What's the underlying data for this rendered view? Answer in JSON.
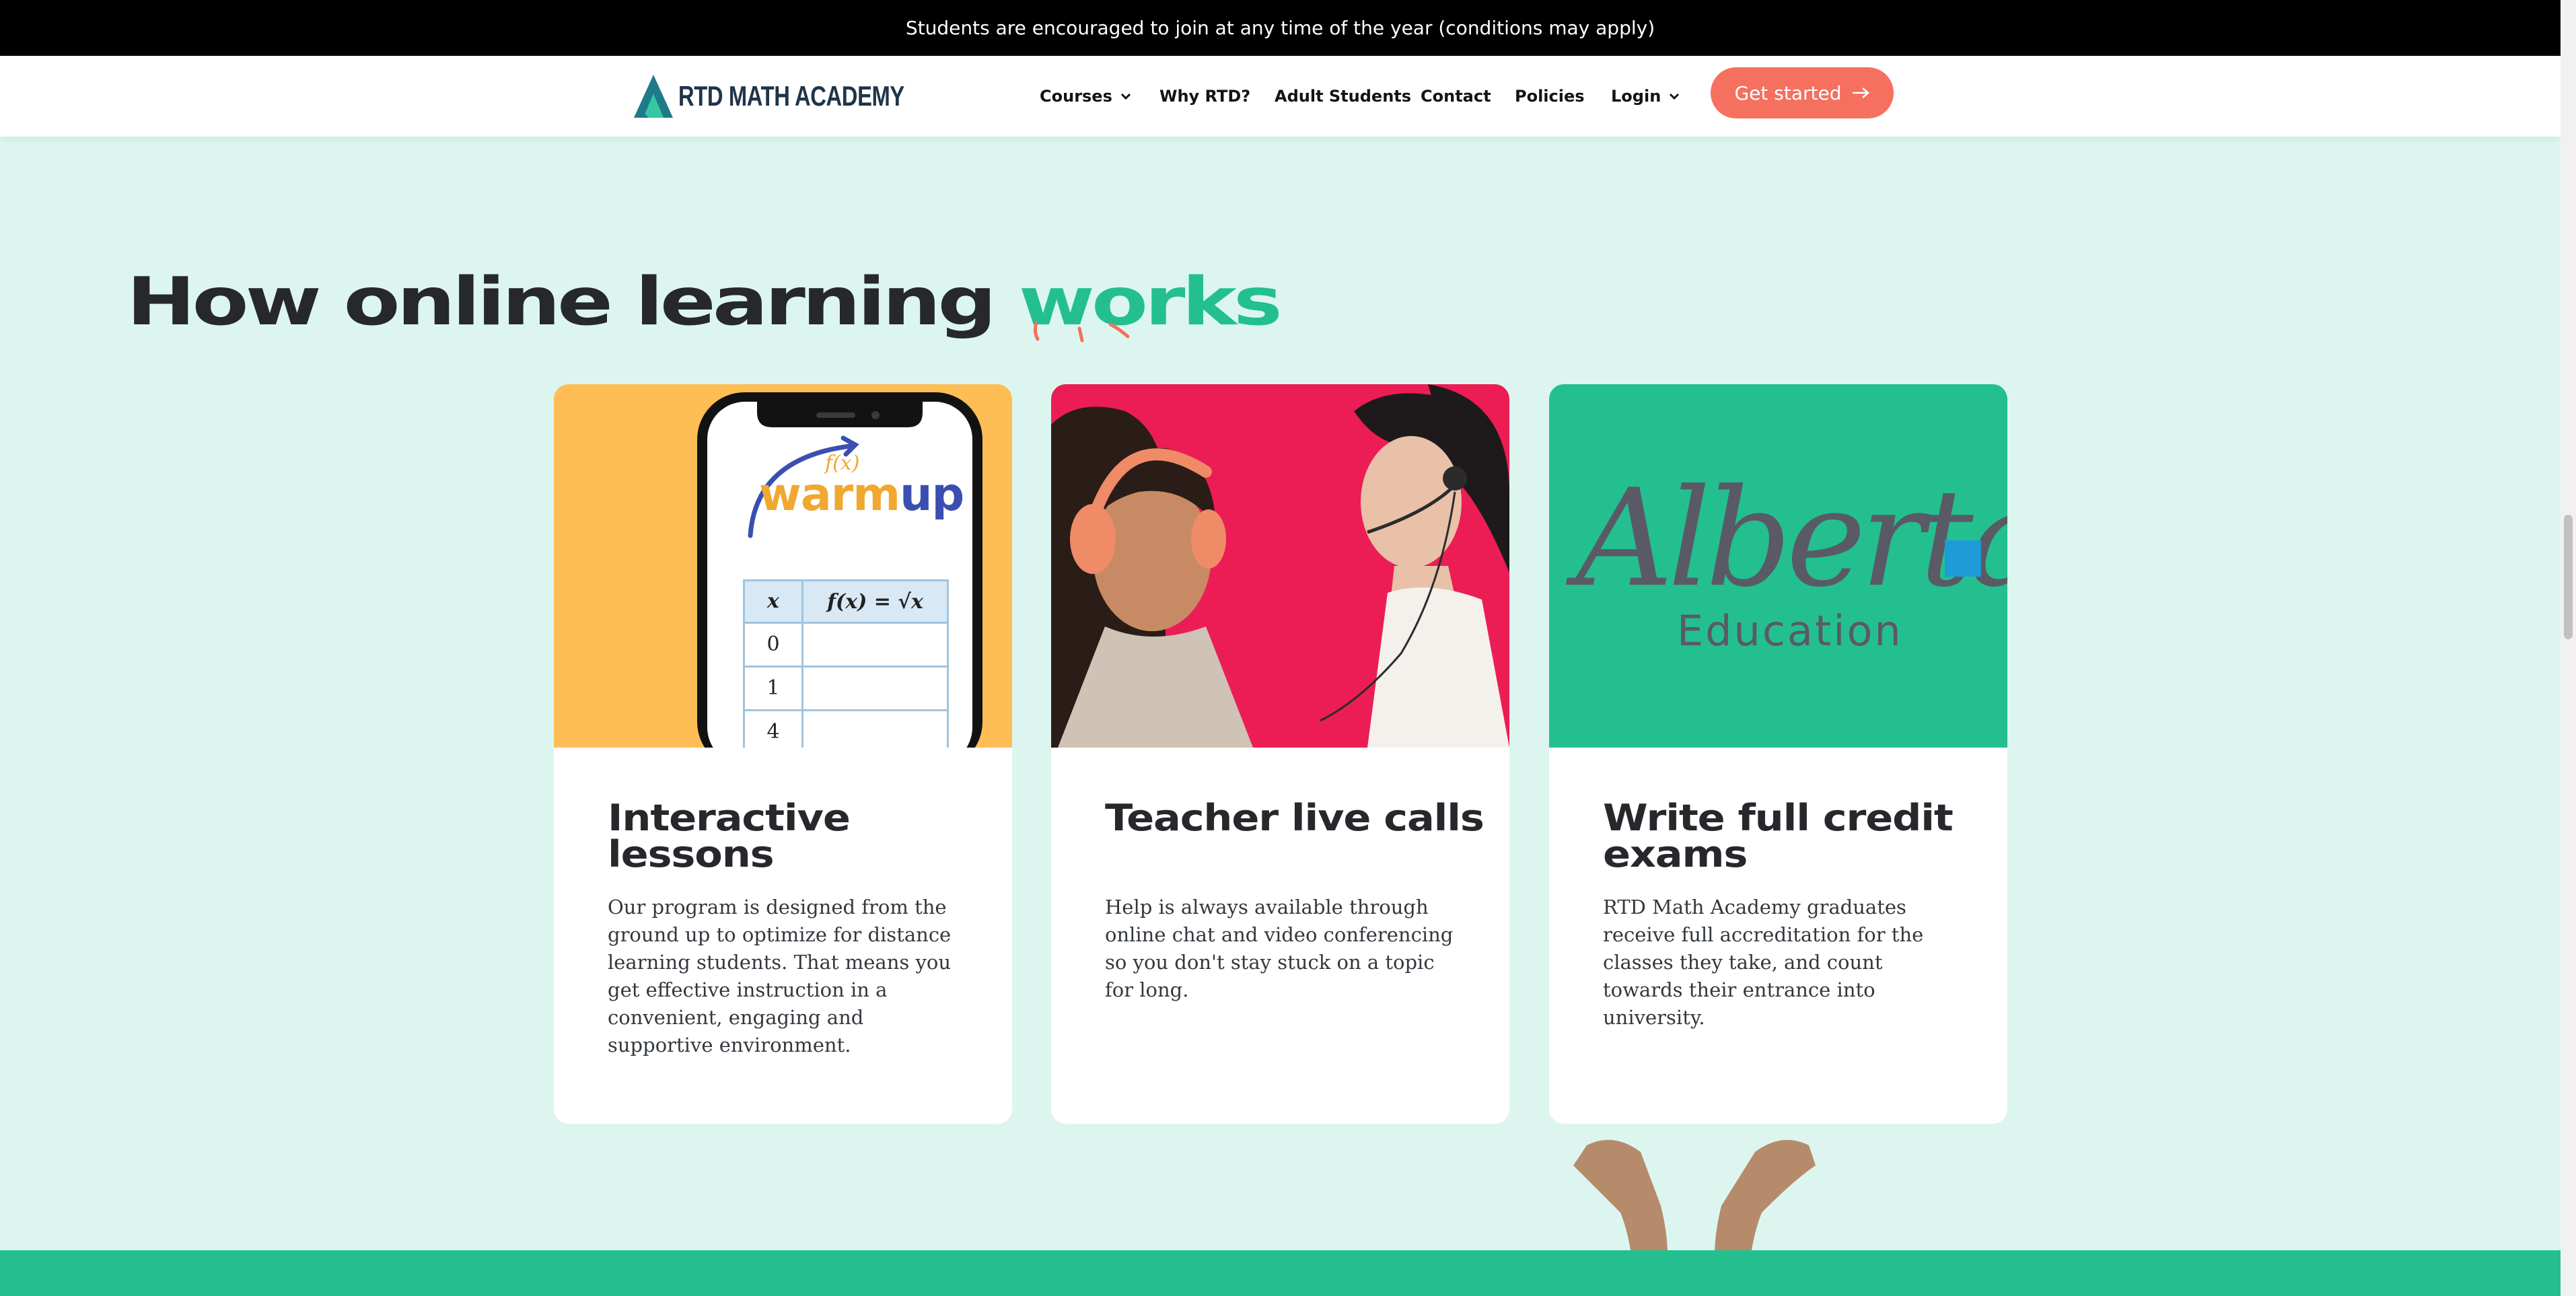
{
  "announcement": {
    "text": "Students are encouraged to join at any time of the year (conditions may apply)"
  },
  "brand": {
    "name": "RTD MATH ACADEMY"
  },
  "nav": {
    "courses": "Courses",
    "why": "Why RTD?",
    "adult": "Adult Students",
    "contact": "Contact",
    "policies": "Policies",
    "login": "Login",
    "cta": "Get started"
  },
  "headline": {
    "main": "How online learning ",
    "accent": "works"
  },
  "cards": [
    {
      "title": "Interactive lessons",
      "body": "Our program is designed from the ground up to optimize for distance learning students. That means you get effective instruction in a convenient, engaging and supportive environment.",
      "image": {
        "heading_main": "warm",
        "heading_accent": "up",
        "curve_label": "f(x)",
        "table_col1": "x",
        "table_col2": "f(x) = √x",
        "rows": [
          "0",
          "1",
          "4"
        ]
      }
    },
    {
      "title": "Teacher live calls",
      "body": "Help is always available through online chat and video conferencing so you don't stay stuck on a topic for long."
    },
    {
      "title": "Write full credit exams",
      "body": "RTD Math Academy graduates receive full accreditation for the classes they take, and count towards their entrance into university.",
      "image": {
        "logo_word": "Alberta",
        "logo_sub": "Education"
      }
    }
  ],
  "colors": {
    "accent": "#24bf8f",
    "cta": "#f5705f",
    "page_bg": "#dcf6ef",
    "card1_bg": "#ffbe55",
    "card2_bg": "#ec1d55"
  }
}
